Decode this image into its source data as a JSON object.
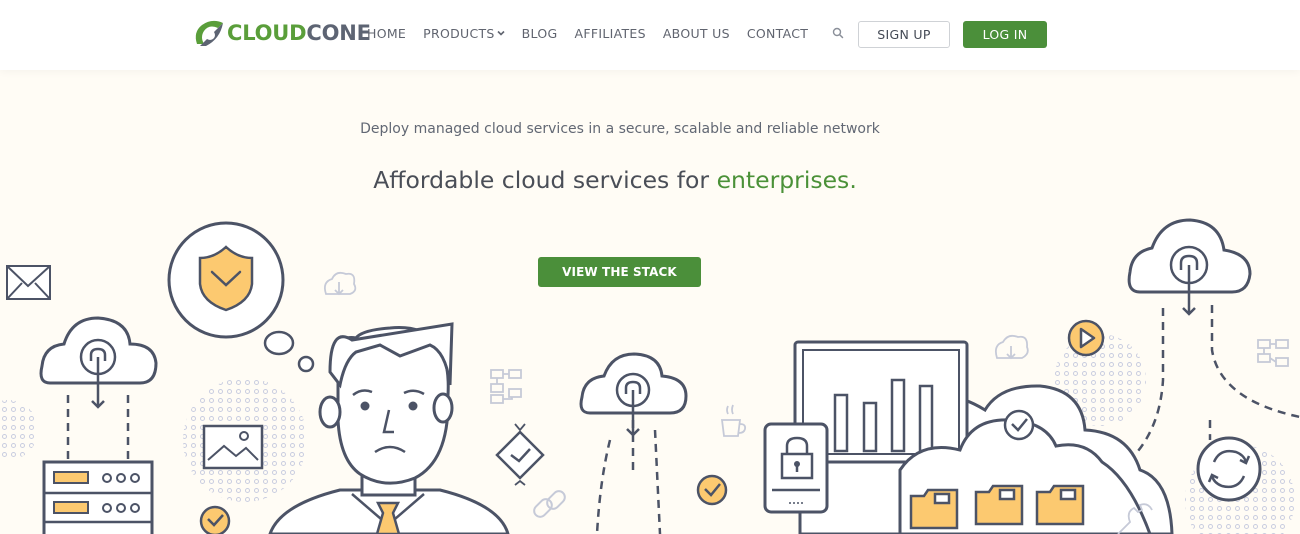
{
  "brand": {
    "part1": "CLOUD",
    "part2": "CONE",
    "color_green": "#5a9e3a",
    "color_gray": "#5d6473"
  },
  "nav": {
    "items": [
      {
        "label": "HOME"
      },
      {
        "label": "PRODUCTS"
      },
      {
        "label": "BLOG"
      },
      {
        "label": "AFFILIATES"
      },
      {
        "label": "ABOUT US"
      },
      {
        "label": "CONTACT"
      }
    ],
    "search_icon": "search-icon",
    "products_icon": "chevron-down-icon"
  },
  "auth": {
    "signup": "SIGN UP",
    "login": "LOG IN"
  },
  "hero": {
    "subtitle": "Deploy managed cloud services in a secure, scalable and reliable network",
    "title_prefix": "Affordable cloud services for ",
    "title_accent": "enterprises",
    "title_suffix": ".",
    "cta": "VIEW THE STACK"
  },
  "colors": {
    "accent": "#4b8f3a",
    "background": "#fffcf5",
    "line": "#4c5366",
    "highlight": "#fcc970"
  }
}
